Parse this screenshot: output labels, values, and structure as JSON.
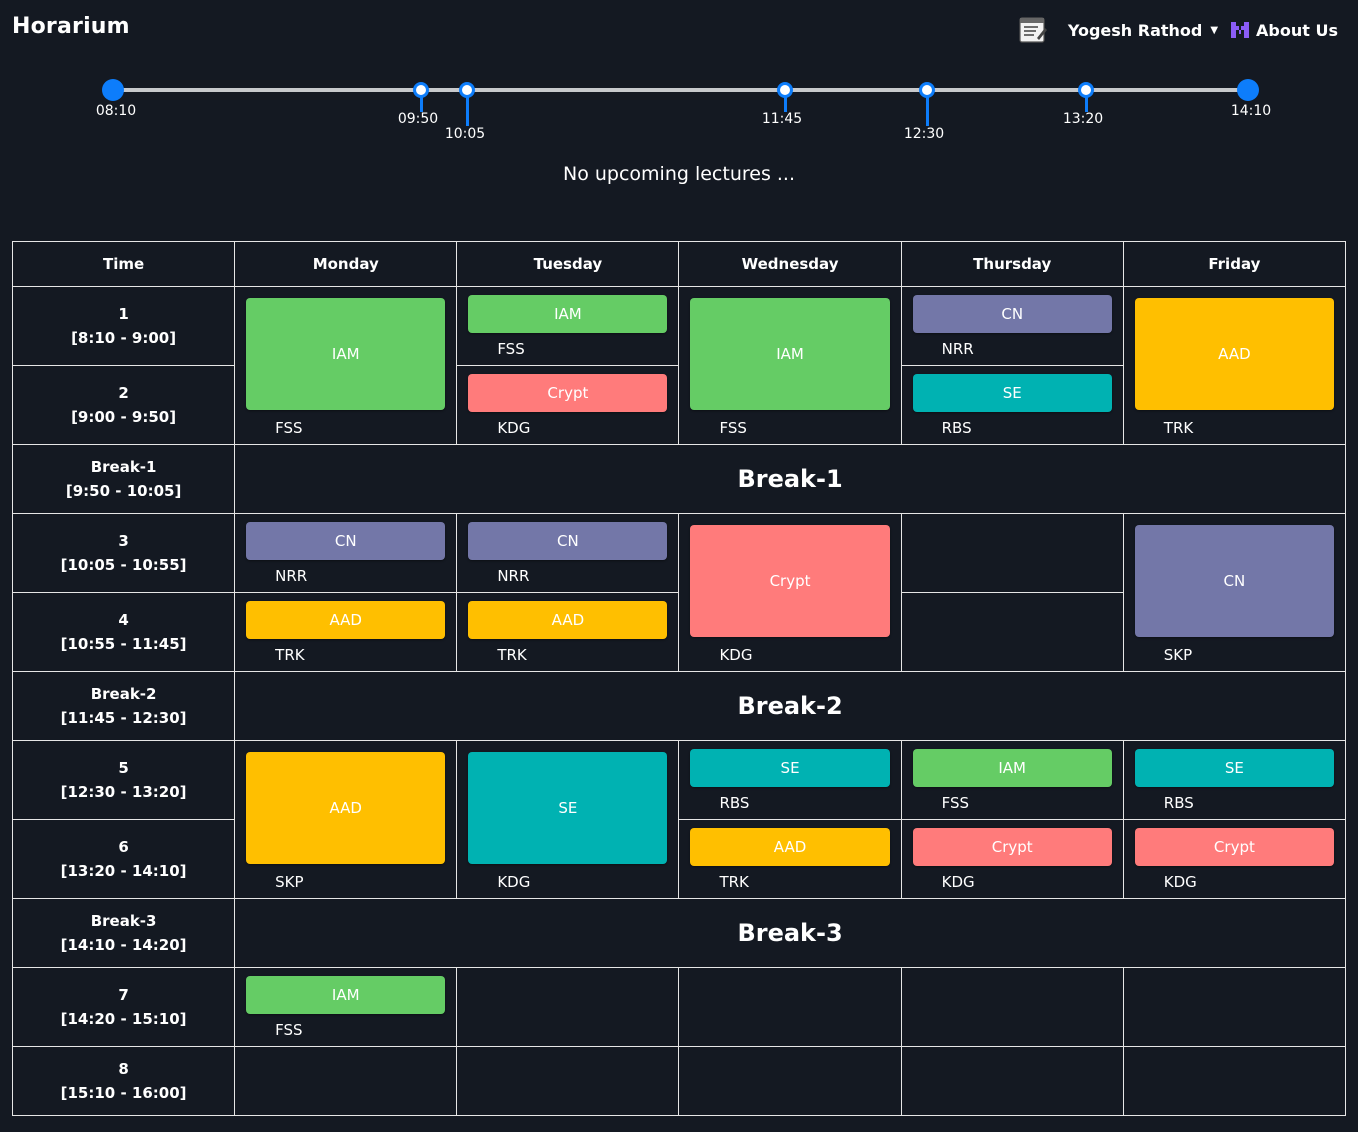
{
  "app": {
    "title": "Horarium"
  },
  "nav": {
    "user": "Yogesh Rathod",
    "about": "About Us",
    "notes_icon": "notes-icon",
    "about_icon": "logo-icon"
  },
  "timeline": {
    "start": "08:10",
    "end": "14:10",
    "markers": [
      "09:50",
      "10:05",
      "11:45",
      "12:30",
      "13:20"
    ]
  },
  "status": "No upcoming lectures ...",
  "colors": {
    "IAM": "#65cc65",
    "CN": "#7377a8",
    "AAD": "#ffbf00",
    "SE": "#00b2b2",
    "Crypt": "#ff7b7b",
    "background": "#141922",
    "accent": "#0d7dfb"
  },
  "table": {
    "headers": [
      "Time",
      "Monday",
      "Tuesday",
      "Wednesday",
      "Thursday",
      "Friday"
    ],
    "rows": {
      "p1": {
        "num": "1",
        "range": "[8:10 - 9:00]"
      },
      "p2": {
        "num": "2",
        "range": "[9:00 - 9:50]"
      },
      "b1": {
        "name": "Break-1",
        "range": "[9:50 - 10:05]",
        "label": "Break-1"
      },
      "p3": {
        "num": "3",
        "range": "[10:05 - 10:55]"
      },
      "p4": {
        "num": "4",
        "range": "[10:55 - 11:45]"
      },
      "b2": {
        "name": "Break-2",
        "range": "[11:45 - 12:30]",
        "label": "Break-2"
      },
      "p5": {
        "num": "5",
        "range": "[12:30 - 13:20]"
      },
      "p6": {
        "num": "6",
        "range": "[13:20 - 14:10]"
      },
      "b3": {
        "name": "Break-3",
        "range": "[14:10 - 14:20]",
        "label": "Break-3"
      },
      "p7": {
        "num": "7",
        "range": "[14:20 - 15:10]"
      },
      "p8": {
        "num": "8",
        "range": "[15:10 - 16:00]"
      }
    },
    "lectures": {
      "mon_p12": {
        "subject": "IAM",
        "prof": "FSS"
      },
      "tue_p1": {
        "subject": "IAM",
        "prof": "FSS"
      },
      "wed_p12": {
        "subject": "IAM",
        "prof": "FSS"
      },
      "thu_p1": {
        "subject": "CN",
        "prof": "NRR"
      },
      "fri_p12": {
        "subject": "AAD",
        "prof": "TRK"
      },
      "tue_p2": {
        "subject": "Crypt",
        "prof": "KDG"
      },
      "thu_p2": {
        "subject": "SE",
        "prof": "RBS"
      },
      "mon_p3": {
        "subject": "CN",
        "prof": "NRR"
      },
      "tue_p3": {
        "subject": "CN",
        "prof": "NRR"
      },
      "wed_p34": {
        "subject": "Crypt",
        "prof": "KDG"
      },
      "fri_p34": {
        "subject": "CN",
        "prof": "SKP"
      },
      "mon_p4": {
        "subject": "AAD",
        "prof": "TRK"
      },
      "tue_p4": {
        "subject": "AAD",
        "prof": "TRK"
      },
      "mon_p56": {
        "subject": "AAD",
        "prof": "SKP"
      },
      "tue_p56": {
        "subject": "SE",
        "prof": "KDG"
      },
      "wed_p5": {
        "subject": "SE",
        "prof": "RBS"
      },
      "thu_p5": {
        "subject": "IAM",
        "prof": "FSS"
      },
      "fri_p5": {
        "subject": "SE",
        "prof": "RBS"
      },
      "wed_p6": {
        "subject": "AAD",
        "prof": "TRK"
      },
      "thu_p6": {
        "subject": "Crypt",
        "prof": "KDG"
      },
      "fri_p6": {
        "subject": "Crypt",
        "prof": "KDG"
      },
      "mon_p7": {
        "subject": "IAM",
        "prof": "FSS"
      }
    }
  }
}
